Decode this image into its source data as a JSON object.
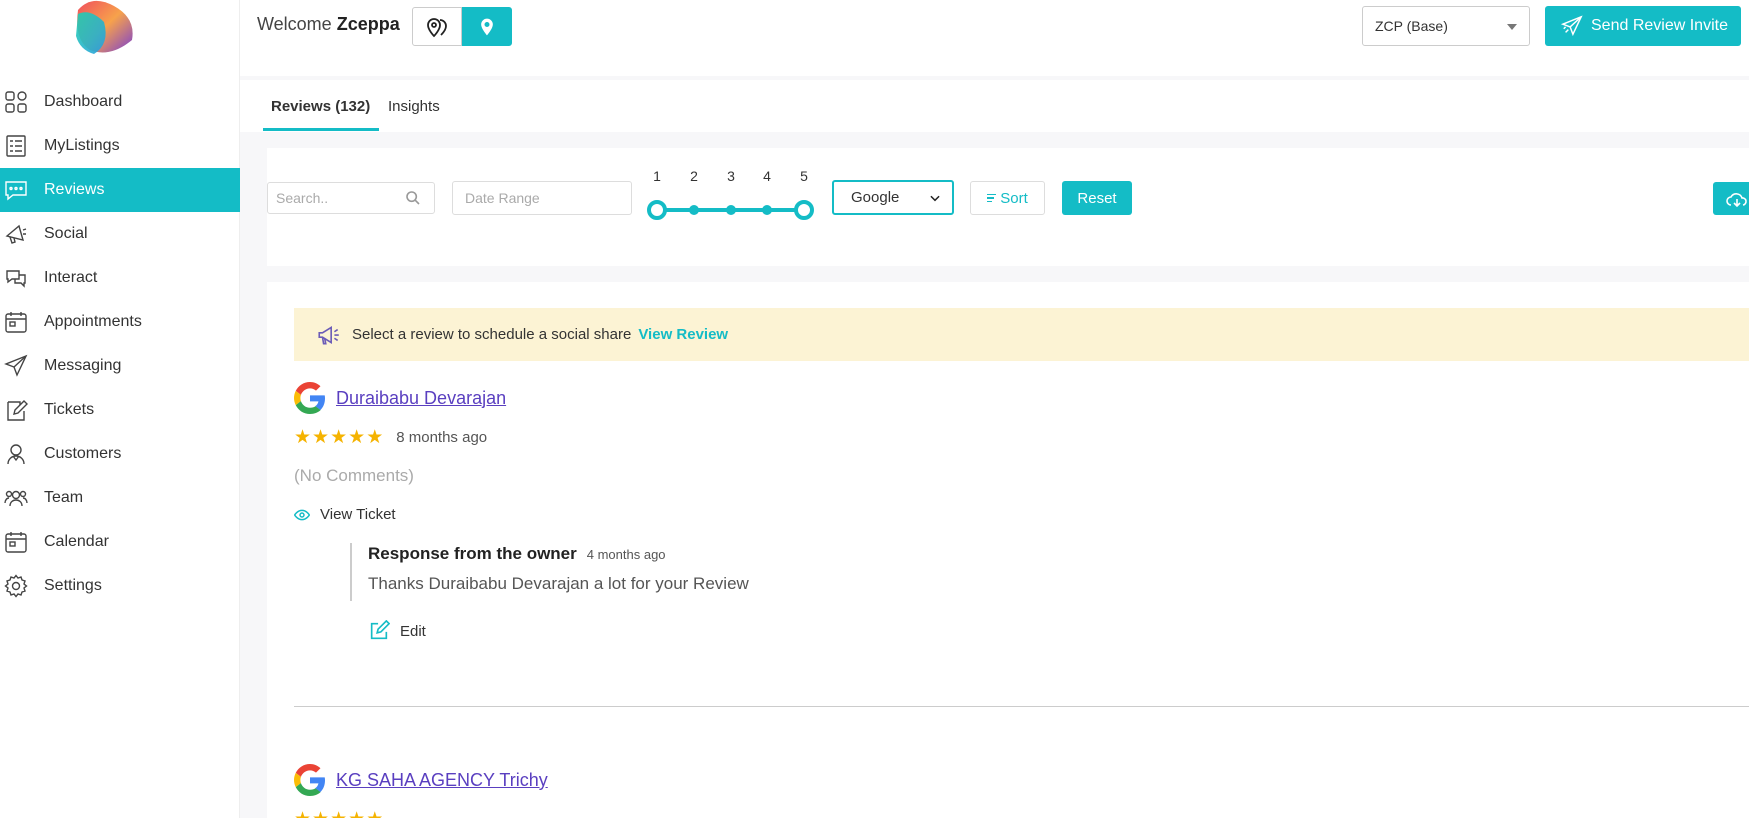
{
  "sidebar": {
    "items": [
      {
        "label": "Dashboard",
        "icon": "dashboard-icon"
      },
      {
        "label": "MyListings",
        "icon": "listings-icon"
      },
      {
        "label": "Reviews",
        "icon": "reviews-icon",
        "active": true
      },
      {
        "label": "Social",
        "icon": "megaphone-icon"
      },
      {
        "label": "Interact",
        "icon": "chat-icon"
      },
      {
        "label": "Appointments",
        "icon": "calendar-icon"
      },
      {
        "label": "Messaging",
        "icon": "send-icon"
      },
      {
        "label": "Tickets",
        "icon": "ticket-icon"
      },
      {
        "label": "Customers",
        "icon": "customer-icon"
      },
      {
        "label": "Team",
        "icon": "team-icon"
      },
      {
        "label": "Calendar",
        "icon": "calendar-icon"
      },
      {
        "label": "Settings",
        "icon": "gear-icon"
      }
    ]
  },
  "header": {
    "welcome_prefix": "Welcome",
    "user_name": "Zceppa",
    "location_select": "ZCP (Base)",
    "invite_label": "Send Review Invite"
  },
  "tabs": {
    "reviews": "Reviews (132)",
    "insights": "Insights"
  },
  "filters": {
    "search_placeholder": "Search..",
    "date_placeholder": "Date Range",
    "rating_numbers": [
      "1",
      "2",
      "3",
      "4",
      "5"
    ],
    "rating_min": 1,
    "rating_max": 5,
    "source": "Google",
    "sort_label": "Sort",
    "reset_label": "Reset"
  },
  "banner": {
    "text": "Select a review to schedule a social share",
    "link": "View Review"
  },
  "reviews": [
    {
      "name": "Duraibabu Devarajan",
      "rating": 5,
      "time": "8 months ago",
      "comment": "(No Comments)",
      "view_ticket": "View Ticket",
      "response_title": "Response from the owner",
      "response_time": "4 months ago",
      "response_text": "Thanks Duraibabu Devarajan a lot for your Review",
      "edit_label": "Edit"
    },
    {
      "name": "KG SAHA AGENCY Trichy",
      "rating": 5
    }
  ],
  "colors": {
    "accent": "#14bcc6",
    "link_purple": "#5a3fc0",
    "star": "#f5b301",
    "banner_bg": "#fcf3d4"
  }
}
